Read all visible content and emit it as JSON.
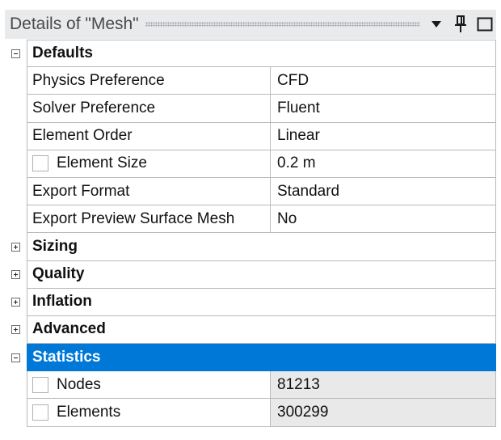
{
  "title": "Details of \"Mesh\"",
  "title_icons": [
    "dropdown-arrow-icon",
    "pin-icon",
    "maximize-icon"
  ],
  "colors": {
    "selected": "#0078d7",
    "readonly": "#e9e9e9",
    "titlebar": "#e9eaec"
  },
  "defaults": {
    "label": "Defaults",
    "rows": [
      {
        "name": "Physics Preference",
        "value": "CFD"
      },
      {
        "name": "Solver Preference",
        "value": "Fluent"
      },
      {
        "name": "Element Order",
        "value": "Linear"
      },
      {
        "name": "Element Size",
        "value": "0.2 m"
      },
      {
        "name": "Export Format",
        "value": "Standard"
      },
      {
        "name": "Export Preview Surface Mesh",
        "value": "No"
      }
    ]
  },
  "categories": {
    "sizing": "Sizing",
    "quality": "Quality",
    "inflation": "Inflation",
    "advanced": "Advanced",
    "statistics": "Statistics"
  },
  "statistics": {
    "rows": [
      {
        "name": "Nodes",
        "value": "81213"
      },
      {
        "name": "Elements",
        "value": "300299"
      }
    ]
  }
}
